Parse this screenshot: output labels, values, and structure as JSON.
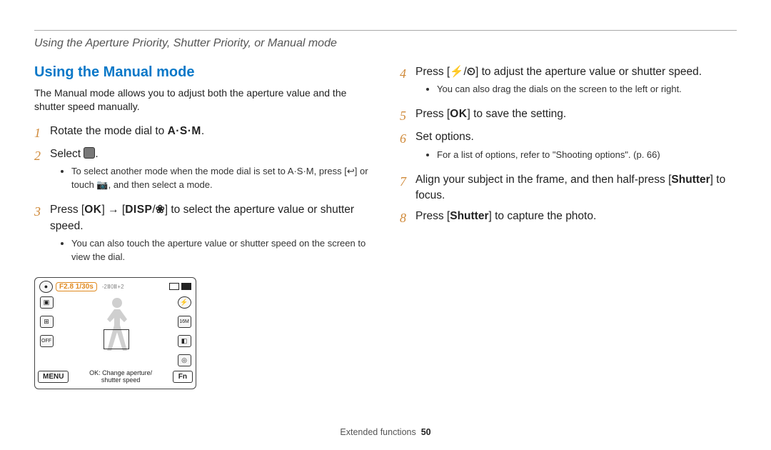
{
  "chapter": "Using the Aperture Priority, Shutter Priority, or Manual mode",
  "heading": "Using the Manual mode",
  "intro": "The Manual mode allows you to adjust both the aperture value and the shutter speed manually.",
  "steps_left": [
    {
      "n": "1",
      "pre": "Rotate the mode dial to ",
      "glyph": "A·S·M",
      "post": "."
    },
    {
      "n": "2",
      "pre": "Select ",
      "icon": true,
      "post": ".",
      "sub": [
        "To select another mode when the mode dial is set to A·S·M, press [↩] or touch 📷, and then select a mode."
      ]
    },
    {
      "n": "3",
      "pre": "Press [",
      "ok": true,
      "mid1": "] → [",
      "disp": true,
      "mid2": "/",
      "macro": true,
      "post": "] to select the aperture value or shutter speed.",
      "sub": [
        "You can also touch the aperture value or shutter speed on the screen to view the dial."
      ]
    }
  ],
  "steps_right": [
    {
      "n": "4",
      "pre": "Press [",
      "flash": true,
      "mid": "/",
      "timer": true,
      "post": "] to adjust the aperture value or shutter speed.",
      "sub": [
        "You can also drag the dials on the screen to the left or right."
      ]
    },
    {
      "n": "5",
      "pre": "Press [",
      "ok": true,
      "post": "] to save the setting."
    },
    {
      "n": "6",
      "pre": "Set options.",
      "sub": [
        "For a list of options, refer to \"Shooting options\". (p. 66)"
      ]
    },
    {
      "n": "7",
      "pre": "Align your subject in the frame, and then half-press [",
      "shutter": true,
      "post": "] to focus."
    },
    {
      "n": "8",
      "pre": "Press [",
      "shutter": true,
      "post": "] to capture the photo."
    }
  ],
  "lcd": {
    "pill": "F2.8 1/30s",
    "expo": [
      "-2",
      "-1",
      "0",
      "+1",
      "+2"
    ],
    "menu": "MENU",
    "fn": "Fn",
    "caption": "OK: Change aperture/\nshutter speed"
  },
  "footer": {
    "label": "Extended functions",
    "page": "50"
  }
}
